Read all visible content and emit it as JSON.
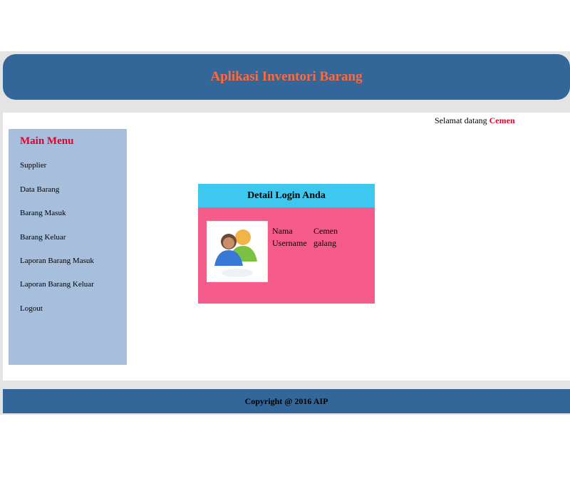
{
  "header": {
    "title": "Aplikasi Inventori Barang"
  },
  "welcome": {
    "prefix": "Selamat datang",
    "user": "Cemen"
  },
  "sidebar": {
    "title": "Main Menu",
    "items": [
      {
        "label": "Supplier"
      },
      {
        "label": "Data Barang"
      },
      {
        "label": "Barang Masuk"
      },
      {
        "label": "Barang Keluar"
      },
      {
        "label": "Laporan Barang Masuk"
      },
      {
        "label": "Laporan Barang Keluar"
      },
      {
        "label": "Logout"
      }
    ]
  },
  "login_panel": {
    "title": "Detail Login Anda",
    "avatar_icon": "users-icon",
    "fields": [
      {
        "key": "Nama",
        "value": "Cemen"
      },
      {
        "key": "Username",
        "value": "galang"
      }
    ]
  },
  "footer": {
    "text": "Copyright @ 2016 AIP"
  },
  "colors": {
    "header_bg": "#336699",
    "title": "#ff6a3d",
    "accent_red": "#e4002b",
    "sidebar_bg": "#a7bfdc",
    "panel_bg": "#f55c8c",
    "panel_head": "#3ec8f0"
  }
}
